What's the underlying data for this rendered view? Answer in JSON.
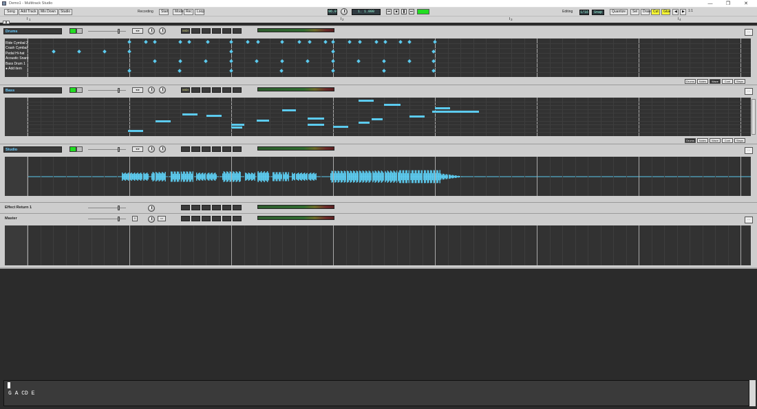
{
  "app": {
    "title": "Demo1 - Multitrack Studio",
    "min": "—",
    "max": "❐",
    "close": "✕"
  },
  "toolbar": {
    "buttons": [
      "Song",
      "Add Track",
      "Mix Down",
      "Studio"
    ],
    "recording_label": "Recording",
    "rec_btn": "Start",
    "rec_btn2": "Mode",
    "rec_btn3": "Rec",
    "rec_btn4": "Loop",
    "tempo": "96.0",
    "position": "1.   1.000",
    "editing_label": "Editing",
    "grid_value": "1/16",
    "snap_label": "Snap",
    "quantize_btn": "Quantize",
    "edit_btns": [
      "Sel",
      "Draw",
      "Cut",
      "Glue"
    ],
    "zoom_label": "1:1"
  },
  "ruler": {
    "marks": [
      "1",
      "2",
      "3",
      "4"
    ]
  },
  "tracks": {
    "drums": {
      "name": "Drums",
      "instrument": "MIDI",
      "volume": "0.0 dB",
      "pan": "C",
      "rows": [
        "Ride Cymbal 2",
        "Crash Cymbal",
        "Pedal Hi-hat",
        "Acoustic Snare",
        "Bass Drum 1"
      ],
      "add_item": "Add item",
      "zoom": [
        "Drums",
        "Notes",
        "Wave",
        "Cont",
        "Steps"
      ]
    },
    "bass": {
      "name": "Bass",
      "instrument": "MIDI",
      "zoom": [
        "Drums",
        "Notes",
        "Wave",
        "Cont",
        "Steps"
      ]
    },
    "studio": {
      "name": "Studio",
      "instrument": "Audio"
    },
    "effect": {
      "name": "Effect Return 1"
    },
    "master": {
      "name": "Master"
    }
  },
  "keyboard": {
    "text": "G A CD E"
  },
  "colors": {
    "note": "#5ccbef",
    "accent_green": "#22dd22",
    "panel_bg": "#323232"
  }
}
